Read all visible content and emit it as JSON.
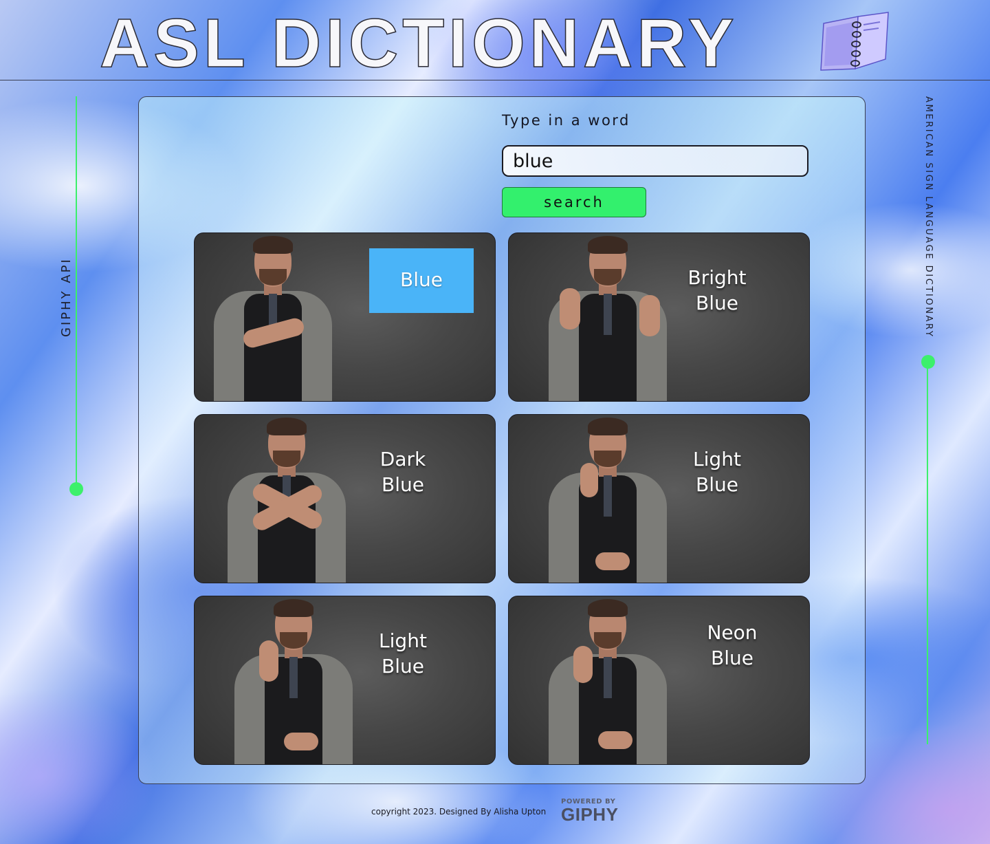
{
  "header": {
    "title": "ASL DICTIONARY",
    "icon": "notebook-icon"
  },
  "sidebar_left": {
    "label": "GIPHY API"
  },
  "sidebar_right": {
    "label": "AMERICAN SIGN LANGUAGE DICTIONARY"
  },
  "search": {
    "prompt": "Type in a word",
    "value": "blue",
    "button_label": "search"
  },
  "results": [
    {
      "label": "Blue"
    },
    {
      "label": "Bright Blue"
    },
    {
      "label": "Dark Blue"
    },
    {
      "label": "Light Blue"
    },
    {
      "label": "Light Blue"
    },
    {
      "label": "Neon Blue"
    }
  ],
  "footer": {
    "copyright": "copyright 2023. Designed By Alisha Upton",
    "powered_by": "POWERED BY",
    "brand": "GIPHY"
  },
  "colors": {
    "accent_green": "#33f06d",
    "label_box_blue": "#4ab4f8"
  }
}
